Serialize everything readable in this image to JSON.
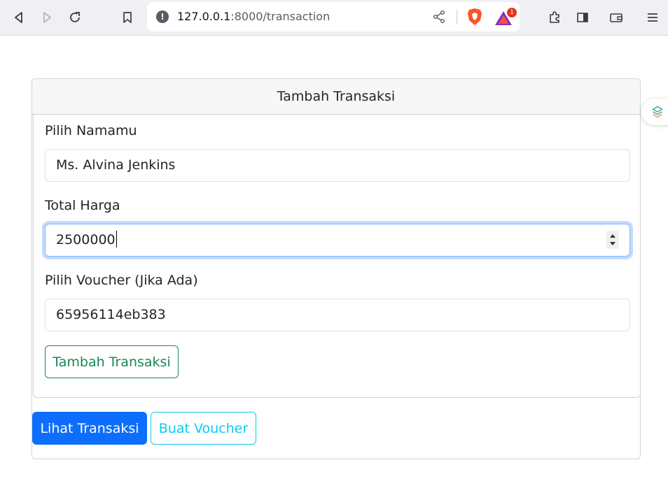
{
  "browser": {
    "url_host": "127.0.0.1",
    "url_path": ":8000/transaction",
    "rewards_badge": "1"
  },
  "form": {
    "header_title": "Tambah Transaksi",
    "name_label": "Pilih Namamu",
    "name_value": "Ms. Alvina Jenkins",
    "price_label": "Total Harga",
    "price_value": "2500000",
    "voucher_label": "Pilih Voucher (Jika Ada)",
    "voucher_value": "65956114eb383",
    "submit_label": "Tambah Transaksi"
  },
  "actions": {
    "view_transactions_label": "Lihat Transaksi",
    "create_voucher_label": "Buat Voucher"
  },
  "colors": {
    "primary": "#0d6efd",
    "success": "#198754",
    "info": "#0dcaf0",
    "focus_ring": "#86b7fe",
    "brave_orange": "#fb542b"
  }
}
